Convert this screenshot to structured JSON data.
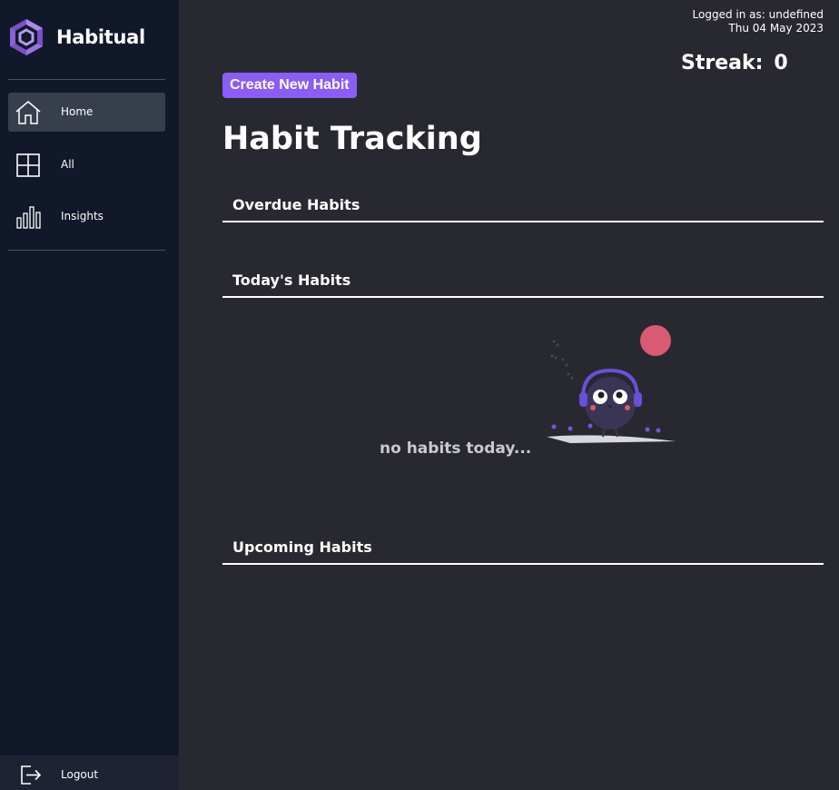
{
  "brand": {
    "name": "Habitual",
    "logo_icon": "hexagon-swirl-logo",
    "accent": "#8b5cf6"
  },
  "sidebar": {
    "items": [
      {
        "label": "Home",
        "icon": "house-icon",
        "active": true
      },
      {
        "label": "All",
        "icon": "grid-icon",
        "active": false
      },
      {
        "label": "Insights",
        "icon": "bar-chart-icon",
        "active": false
      }
    ],
    "logout": {
      "label": "Logout",
      "icon": "logout-icon"
    }
  },
  "header": {
    "logged_in": "Logged in as: undefined",
    "date": "Thu 04 May 2023",
    "streak_label": "Streak:",
    "streak_value": "0"
  },
  "main": {
    "create_button": "Create New Habit",
    "title": "Habit Tracking",
    "sections": {
      "overdue": "Overdue Habits",
      "today": "Today's Habits",
      "upcoming": "Upcoming Habits"
    },
    "empty_today": "no habits today..."
  }
}
